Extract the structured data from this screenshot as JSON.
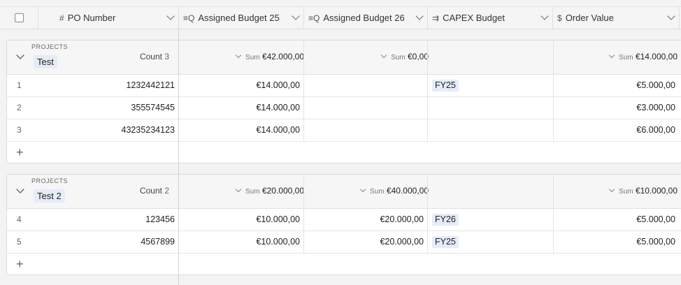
{
  "columns": [
    {
      "label": "PO Number",
      "icon": "#"
    },
    {
      "label": "Assigned Budget 25",
      "icon": "≡Q"
    },
    {
      "label": "Assigned Budget 26",
      "icon": "≡Q"
    },
    {
      "label": "CAPEX Budget",
      "icon": "⇉"
    },
    {
      "label": "Order Value",
      "icon": "$"
    }
  ],
  "groups": [
    {
      "field_label": "PROJECTS",
      "name": "Test",
      "count_label": "Count",
      "count": "3",
      "sum_label": "Sum",
      "sums": [
        "€42.000,00",
        "€0,00",
        "€14.000,00"
      ],
      "rows": [
        {
          "n": "1",
          "po": "1232442121",
          "b25": "€14.000,00",
          "b26": "",
          "capex": "FY25",
          "order": "€5.000,00"
        },
        {
          "n": "2",
          "po": "355574545",
          "b25": "€14.000,00",
          "b26": "",
          "capex": "",
          "order": "€3.000,00"
        },
        {
          "n": "3",
          "po": "43235234123",
          "b25": "€14.000,00",
          "b26": "",
          "capex": "",
          "order": "€6.000,00"
        }
      ],
      "add_symbol": "+"
    },
    {
      "field_label": "PROJECTS",
      "name": "Test 2",
      "count_label": "Count",
      "count": "2",
      "sum_label": "Sum",
      "sums": [
        "€20.000,00",
        "€40.000,00",
        "€10.000,00"
      ],
      "rows": [
        {
          "n": "4",
          "po": "123456",
          "b25": "€10.000,00",
          "b26": "€20.000,00",
          "capex": "FY26",
          "order": "€5.000,00"
        },
        {
          "n": "5",
          "po": "4567899",
          "b25": "€10.000,00",
          "b26": "€20.000,00",
          "capex": "FY25",
          "order": "€5.000,00"
        }
      ],
      "add_symbol": "+"
    }
  ]
}
